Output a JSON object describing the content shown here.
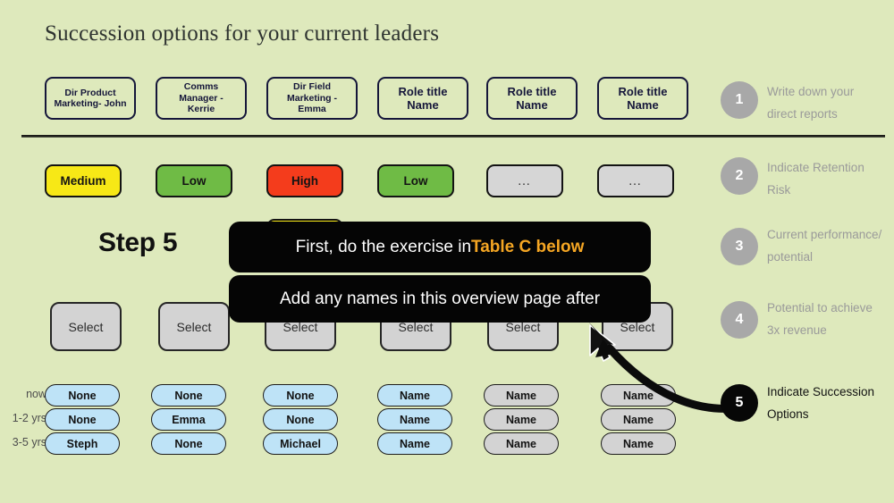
{
  "page": {
    "title": "Succession options for your current leaders",
    "background_color": "#dee9bc",
    "step_label": "Step 5"
  },
  "columns": [
    {
      "role": "Dir Product\nMarketing- John",
      "role_line1": "Dir Product",
      "role_line2": "Marketing- John",
      "risk": "Medium",
      "risk_color": "#f7e816",
      "select": "Select",
      "succession": [
        "None",
        "None",
        "Steph"
      ],
      "succession_color": "#bee3f7"
    },
    {
      "role_line1": "Comms",
      "role_line2": "Manager -",
      "role_line3": "Kerrie",
      "risk": "Low",
      "risk_color": "#6fbb45",
      "select": "Select",
      "succession": [
        "None",
        "Emma",
        "None"
      ],
      "succession_color": "#bee3f7"
    },
    {
      "role_line1": "Dir Field",
      "role_line2": "Marketing -",
      "role_line3": "Emma",
      "risk": "High",
      "risk_color": "#f43c1c",
      "select": "Select",
      "succession": [
        "None",
        "None",
        "Michael"
      ],
      "succession_color": "#bee3f7"
    },
    {
      "role_line1": "Role title",
      "role_line2": "Name",
      "risk": "Low",
      "risk_color": "#6fbb45",
      "select": "Select",
      "succession": [
        "Name",
        "Name",
        "Name"
      ],
      "succession_color": "#bee3f7"
    },
    {
      "role_line1": "Role title",
      "role_line2": "Name",
      "risk": "…",
      "risk_color": "#d6d6d6",
      "select": "Select",
      "succession": [
        "Name",
        "Name",
        "Name"
      ],
      "succession_color": "#d3d3d3"
    },
    {
      "role_line1": "Role title",
      "role_line2": "Name",
      "risk": "…",
      "risk_color": "#d6d6d6",
      "select": "Select",
      "succession": [
        "Name",
        "Name",
        "Name"
      ],
      "succession_color": "#d3d3d3"
    }
  ],
  "row_labels": [
    "now",
    "1-2 yrs",
    "3-5 yrs"
  ],
  "callouts": [
    {
      "plain": "First, do the exercise in ",
      "accent": "Table C below",
      "accent_color": "#f5a623"
    },
    {
      "plain": "Add any names in this overview page after",
      "accent": "",
      "accent_color": "#f5a623"
    }
  ],
  "legend": [
    {
      "number": "1",
      "line1": "Write down your",
      "line2": "direct reports",
      "state": "inactive"
    },
    {
      "number": "2",
      "line1": "Indicate Retention",
      "line2": "Risk",
      "state": "inactive"
    },
    {
      "number": "3",
      "line1": "Current performance/",
      "line2": "potential",
      "state": "inactive"
    },
    {
      "number": "4",
      "line1": "Potential to achieve",
      "line2": "3x revenue",
      "state": "inactive"
    },
    {
      "number": "5",
      "line1": "Indicate Succession",
      "line2": "Options",
      "state": "active"
    }
  ]
}
